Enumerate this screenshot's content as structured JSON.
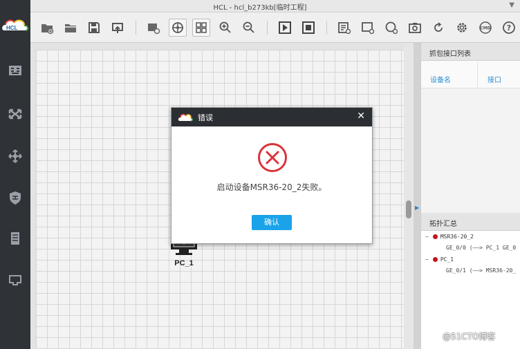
{
  "window": {
    "title": "HCL - hcl_b273kb[临时工程]",
    "menu_glyph": "▼"
  },
  "sidebar": {
    "logo_text": "HCL",
    "items": [
      {
        "icon": "router-icon"
      },
      {
        "icon": "switch-icon"
      },
      {
        "icon": "hub-icon"
      },
      {
        "icon": "firewall-icon"
      },
      {
        "icon": "server-icon"
      },
      {
        "icon": "connection-icon"
      }
    ]
  },
  "toolbar": {
    "buttons": [
      "new-project-icon",
      "open-folder-icon",
      "save-icon",
      "export-icon",
      "screenshot-icon",
      "topology-icon",
      "grid-icon",
      "zoom-in-icon",
      "zoom-out-icon",
      "start-icon",
      "stop-icon",
      "add-note-icon",
      "add-rect-icon",
      "add-ellipse-icon",
      "camera-icon",
      "refresh-icon",
      "settings-icon",
      "cmd-icon",
      "help-icon"
    ],
    "cmd_label": "CMD"
  },
  "canvas": {
    "device": {
      "label": "PC_1",
      "icon": "pc-monitor-icon"
    }
  },
  "right_panel": {
    "capture_title": "抓包接口列表",
    "capture_columns": [
      "设备名",
      "接口"
    ],
    "topology_title": "拓扑汇总",
    "topology": [
      {
        "toggle": "−",
        "name": "MSR36-20_2",
        "link": "GE_0/0 (——> PC_1 GE_0"
      },
      {
        "toggle": "−",
        "name": "PC_1",
        "link": "GE_0/1 (——> MSR36-20_"
      }
    ]
  },
  "dialog": {
    "title": "错误",
    "close_glyph": "✕",
    "message": "启动设备MSR36-20_2失败。",
    "ok_label": "确认"
  },
  "watermark": "@51CTO博客",
  "colors": {
    "sidebar_bg": "#2f3337",
    "dialog_header": "#2b2f33",
    "error_red": "#d9343a",
    "button_blue": "#1aa3e8",
    "link_blue": "#2b8fd0",
    "node_dot": "#c0141a"
  }
}
